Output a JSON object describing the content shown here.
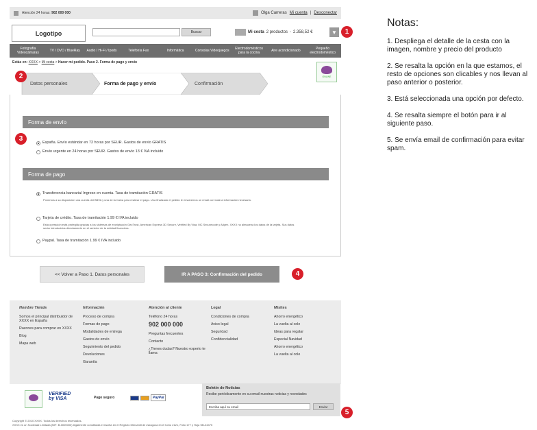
{
  "topbar": {
    "phone_label": "Atención 24 horas:",
    "phone_number": "902 000 000",
    "user_name": "Olga Carreras",
    "my_account": "Mi cuenta",
    "separator": "|",
    "logout": "Desconectar"
  },
  "header": {
    "logo": "Logotipo",
    "search_button": "Buscar",
    "cart_label": "Mi cesta",
    "cart_count": "2 productos",
    "cart_dash": "-",
    "cart_total": "2.358,52 €",
    "cart_toggle_icon": "▼"
  },
  "nav": [
    "Fotografía Videocámaras",
    "TV / DVD / BlueRay",
    "Audio / Hi-Fi / Ipods",
    "Telefonía Fax",
    "Informática",
    "Consolas Videojuegos",
    "Electrodomésticos para la cocina",
    "Aire acondicionado",
    "Pequeño electrodoméstico"
  ],
  "breadcrumb": {
    "prefix": "Estás en:",
    "home": "XXXX",
    "sep1": ">",
    "account": "Mi cesta",
    "sep2": ">",
    "current": "Hacer mi pedido. Paso 2. Forma de pago y envío"
  },
  "seal_label": "ONLINE",
  "steps": [
    "Datos personales",
    "Forma de pago y envío",
    "Confirmación"
  ],
  "shipping": {
    "title": "Forma de envío",
    "options": [
      {
        "text": "España. Envío estándar en 72 horas por SEUR. Gastos de envío GRATIS",
        "selected": true
      },
      {
        "text": "Envío urgente en 24 horas por SEUR. Gastos de envío 13 € IVA incluido",
        "selected": false
      }
    ]
  },
  "payment": {
    "title": "Forma de pago",
    "options": [
      {
        "text": "Transferencia bancaria/ Ingreso en cuenta. Tasa de tramitación GRATIS",
        "desc": "Ponemos a su disposición una cuenta del BBVA y una de la Caixa para realizar el pago. Una finalizado el pedido le enviaremos un email con toda la información necesaria.",
        "selected": true
      },
      {
        "text": "Tarjeta de crédito. Tasa de tramitación 1.99 € IVA incluido",
        "desc": "Esta operación está protegida gracias a los sistemas de encriptación GeoTrust, American Express 3D Secure, Verified By Visa, MC Securecode y Adyen. XXXX no almacena los datos de la tarjeta. Sus datos serán introducidos directamente en el servidor de la entidad financiera.",
        "selected": false
      },
      {
        "text": "Paypal. Tasa de tramitación 1.99 € IVA incluido",
        "desc": "",
        "selected": false
      }
    ]
  },
  "buttons": {
    "back": "<< Volver a Paso 1. Datos personales",
    "next": "IR A PASO 3: Confirmación del pedido"
  },
  "footer": {
    "columns": [
      {
        "title": "Nombre Tienda",
        "items": [
          "Somos el principal distribuidor de XXXX en España",
          "Razones para comprar en XXXX",
          "Blog",
          "Mapa web"
        ]
      },
      {
        "title": "Información",
        "items": [
          "Proceso de compra",
          "Formas de pago",
          "Modalidades de entrega",
          "Gastos de envío",
          "Seguimiento del pedido",
          "Devoluciones",
          "Garantía"
        ]
      },
      {
        "title": "Atención al cliente",
        "phone_label": "Teléfono 24 horas",
        "phone": "902 000 000",
        "items": [
          "Preguntas frecuentes",
          "Contacto",
          "¿Tienes dudas? Nuestro experto te llama"
        ]
      },
      {
        "title": "Legal",
        "items": [
          "Condiciones de compra",
          "Aviso legal",
          "Seguridad",
          "Confidencialidad"
        ]
      },
      {
        "title": "Misites",
        "items": [
          "Ahorro energético",
          "La vuelta al cole",
          "Ideas para regalar",
          "Especial Navidad",
          "Ahorro energético",
          "La vuelta al cole"
        ]
      }
    ],
    "secure_payment": "Pago seguro",
    "verified_visa": "VERIFIED by VISA",
    "card_paypal": "PayPal",
    "newsletter_title": "Boletín de Noticias",
    "newsletter_text": "Recibe periódicamente en su email nuestras noticias y novedades",
    "newsletter_placeholder": "Escriba aquí su email",
    "newsletter_button": "Enviar",
    "copyright": "Copyright © 2010 XXXX. Todos los derechos reservados.",
    "legal_line": "XXXX es un Sociedad Limitada (NIF: B-0000000) legalmente constituida e inscrita en el Registro Mercantil de Zaragoza en el tomo 2121, Folio 177 y Hoja SB-24475"
  },
  "markers": [
    "1",
    "2",
    "3",
    "4",
    "5"
  ],
  "notes": {
    "title": "Notas:",
    "items": [
      "1. Despliega el detalle de la cesta con la imagen, nombre y precio del producto",
      "2. Se resalta la opción en la que estamos, el resto de opciones son clicables y nos llevan al paso anterior o posterior.",
      "3. Está seleccionada una opción por defecto.",
      "4. Se resalta siempre el botón para ir al siguiente paso.",
      "5. Se envía email de confirmación para evitar spam."
    ]
  },
  "colors": {
    "marker": "#d81f2a",
    "nav": "#6e6e6e",
    "section_header": "#8a8a8a",
    "next_button": "#8c8c8c"
  }
}
